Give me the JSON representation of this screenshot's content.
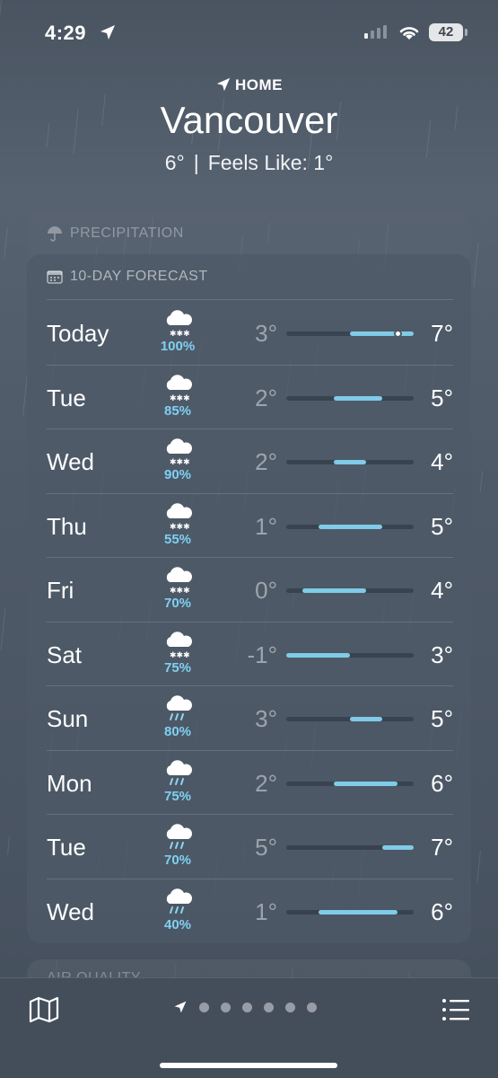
{
  "status_bar": {
    "time": "4:29",
    "battery": "42"
  },
  "header": {
    "home_label": "HOME",
    "city": "Vancouver",
    "current_temp": "6°",
    "separator": "|",
    "feels_like": "Feels Like: 1°"
  },
  "precipitation_card": {
    "label": "PRECIPITATION"
  },
  "forecast": {
    "label": "10-DAY FORECAST",
    "range_min": -1,
    "range_max": 7,
    "days": [
      {
        "day": "Today",
        "icon": "snow-cloud-icon",
        "pop": "100%",
        "lo": "3°",
        "hi": "7°",
        "lo_val": 3,
        "hi_val": 7,
        "current": 6
      },
      {
        "day": "Tue",
        "icon": "snow-cloud-icon",
        "pop": "85%",
        "lo": "2°",
        "hi": "5°",
        "lo_val": 2,
        "hi_val": 5
      },
      {
        "day": "Wed",
        "icon": "snow-cloud-icon",
        "pop": "90%",
        "lo": "2°",
        "hi": "4°",
        "lo_val": 2,
        "hi_val": 4
      },
      {
        "day": "Thu",
        "icon": "snow-cloud-icon",
        "pop": "55%",
        "lo": "1°",
        "hi": "5°",
        "lo_val": 1,
        "hi_val": 5
      },
      {
        "day": "Fri",
        "icon": "snow-cloud-icon",
        "pop": "70%",
        "lo": "0°",
        "hi": "4°",
        "lo_val": 0,
        "hi_val": 4
      },
      {
        "day": "Sat",
        "icon": "snow-cloud-icon",
        "pop": "75%",
        "lo": "-1°",
        "hi": "3°",
        "lo_val": -1,
        "hi_val": 3
      },
      {
        "day": "Sun",
        "icon": "rain-cloud-icon",
        "pop": "80%",
        "lo": "3°",
        "hi": "5°",
        "lo_val": 3,
        "hi_val": 5
      },
      {
        "day": "Mon",
        "icon": "rain-cloud-icon",
        "pop": "75%",
        "lo": "2°",
        "hi": "6°",
        "lo_val": 2,
        "hi_val": 6
      },
      {
        "day": "Tue",
        "icon": "rain-cloud-icon",
        "pop": "70%",
        "lo": "5°",
        "hi": "7°",
        "lo_val": 5,
        "hi_val": 7
      },
      {
        "day": "Wed",
        "icon": "rain-cloud-icon",
        "pop": "40%",
        "lo": "1°",
        "hi": "6°",
        "lo_val": 1,
        "hi_val": 6
      }
    ]
  },
  "air_quality_card": {
    "label": "AIR QUALITY"
  },
  "toolbar": {
    "map_icon": "map-icon",
    "list_icon": "list-icon",
    "page_count": 6,
    "active_page": 0
  },
  "colors": {
    "accent_bar": "#7fcbe8",
    "precip_text": "#7fd0f3"
  }
}
